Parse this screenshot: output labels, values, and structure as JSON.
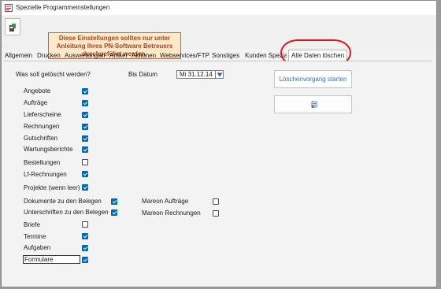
{
  "window": {
    "title": "Spezielle Programmeinstellungen"
  },
  "warning": {
    "line1": "Diese Einstellungen sollten nur unter",
    "line2": "Anleitung Ihres PN-Software Betreuers",
    "line3": "durchgeführt werden."
  },
  "tabs": [
    {
      "label": "Allgemein"
    },
    {
      "label": "Drucken"
    },
    {
      "label": "Auswertungen"
    },
    {
      "label": "Artikel"
    },
    {
      "label": "Aktionen"
    },
    {
      "label": "Webservices/FTP"
    },
    {
      "label": "Sonstiges"
    },
    {
      "label": "Kunden Spezial"
    },
    {
      "label": "Alte Daten löschen",
      "active": true
    }
  ],
  "form": {
    "question": "Was soll gelöscht werden?",
    "bis_datum_label": "Bis Datum",
    "bis_datum_value": "Mi 31.12.14",
    "start_button": "Löschenvorgang starten"
  },
  "options_left": [
    {
      "label": "Angebote",
      "checked": true
    },
    {
      "label": "Aufträge",
      "checked": true
    },
    {
      "label": "Lieferscheine",
      "checked": true
    },
    {
      "label": "Rechnungen",
      "checked": true
    },
    {
      "label": "Gutschriften",
      "checked": true
    },
    {
      "label": "Wartungsberichte",
      "checked": true
    },
    {
      "label": "Bestellungen",
      "checked": false
    },
    {
      "label": "Lf-Rechnungen",
      "checked": true
    },
    {
      "label": "Projekte (wenn leer)",
      "checked": true
    },
    {
      "label": "Dokumente zu den Belegen",
      "checked": true
    },
    {
      "label": "Unterschriften zu den Belegen",
      "checked": true
    },
    {
      "label": "Briefe",
      "checked": false
    },
    {
      "label": "Termine",
      "checked": true
    },
    {
      "label": "Aufgaben",
      "checked": true
    },
    {
      "label": "Formulare",
      "checked": true
    }
  ],
  "options_right": [
    {
      "label": "Mareon Aufträge",
      "checked": false
    },
    {
      "label": "Mareon Rechnungen",
      "checked": false
    }
  ],
  "colors": {
    "accent": "#0067c0",
    "warning_text": "#a4442a",
    "warning_bg": "#fde9c8",
    "highlight": "#e8141d"
  }
}
